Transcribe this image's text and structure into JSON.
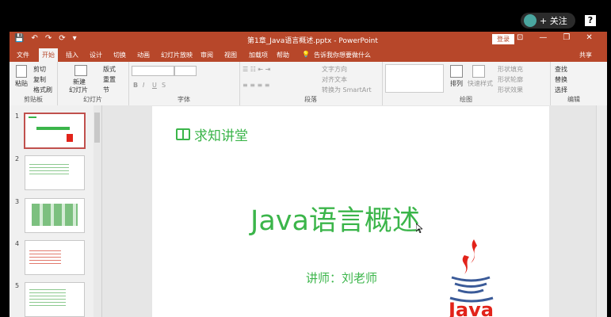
{
  "overlay": {
    "follow_label": "+ 关注",
    "help_label": "?"
  },
  "titlebar": {
    "doc_title": "第1章_Java语言概述.pptx - PowerPoint",
    "login_label": "登录",
    "qat": [
      "💾",
      "↶",
      "↷",
      "⟳",
      "▾"
    ],
    "window_controls": [
      "⊡",
      "—",
      "❐",
      "✕"
    ]
  },
  "tabs": [
    "文件",
    "开始",
    "插入",
    "设计",
    "切换",
    "动画",
    "幻灯片放映",
    "审阅",
    "视图",
    "加载项",
    "帮助",
    "告诉我你想要做什么",
    "共享"
  ],
  "ribbon": {
    "clipboard": {
      "paste": "粘贴",
      "cut": "剪切",
      "copy": "复制",
      "format_painter": "格式刷",
      "label": "剪贴板"
    },
    "slides": {
      "new_slide": "新建",
      "new_slide2": "幻灯片",
      "layout": "版式",
      "reset": "重置",
      "section": "节",
      "label": "幻灯片"
    },
    "font": {
      "bold": "B",
      "italic": "I",
      "underline": "U",
      "strike": "S",
      "label": "字体"
    },
    "paragraph": {
      "text_direction": "文字方向",
      "align_text": "对齐文本",
      "smartart": "转换为 SmartArt",
      "label": "段落"
    },
    "drawing": {
      "arrange": "排列",
      "quick_styles": "快速样式",
      "fill": "形状填充",
      "outline": "形状轮廓",
      "effects": "形状效果",
      "label": "绘图"
    },
    "editing": {
      "find": "查找",
      "replace": "替换",
      "select": "选择",
      "label": "编辑"
    }
  },
  "thumbnails": [
    "1",
    "2",
    "3",
    "4",
    "5"
  ],
  "slide": {
    "brand": "求知讲堂",
    "title": "Java语言概述",
    "subtitle": "讲师：刘老师",
    "logo_text": "Java",
    "accent": "#3bb54a",
    "logo_red": "#e2231a",
    "logo_blue": "#3a5a98"
  }
}
